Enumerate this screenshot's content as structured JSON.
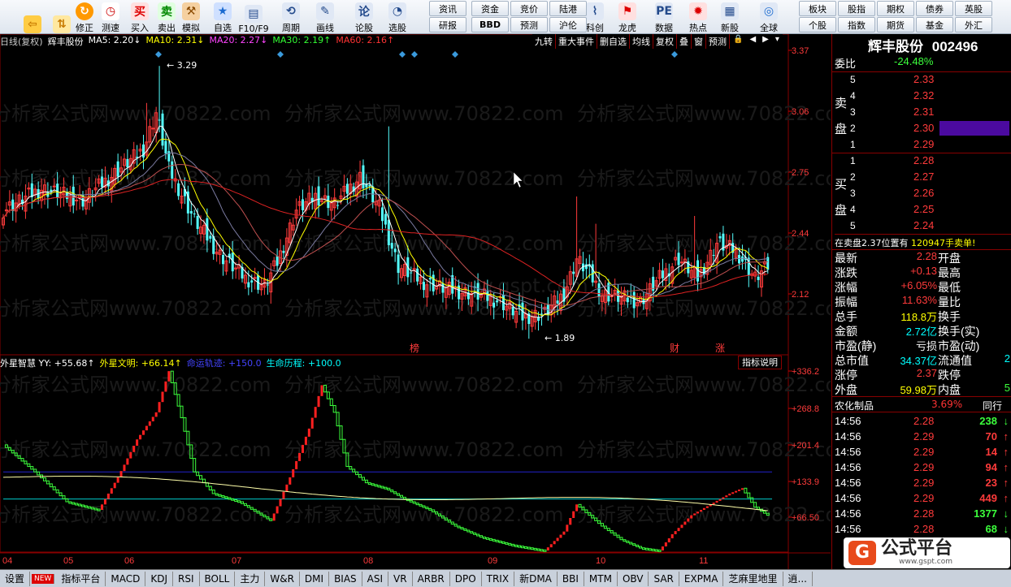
{
  "toolbar": {
    "tall": [
      {
        "label": "",
        "icon": "back-arrow-icon"
      },
      {
        "label": "",
        "icon": "up-down-arrows-icon"
      },
      {
        "label": "修正",
        "icon": "correction-icon"
      },
      {
        "label": "测速",
        "icon": "speed-test-icon"
      },
      {
        "label": "买入",
        "icon": "buy-icon",
        "glyph": "买"
      },
      {
        "label": "卖出",
        "icon": "sell-icon",
        "glyph": "卖"
      },
      {
        "label": "模拟",
        "icon": "simulate-hammer-icon"
      },
      {
        "label": "自选",
        "icon": "favorite-icon"
      },
      {
        "label": "F10/F9",
        "icon": "f10-icon"
      },
      {
        "label": "周期",
        "icon": "period-icon"
      },
      {
        "label": "画线",
        "icon": "draw-line-icon"
      },
      {
        "label": "论股",
        "icon": "forum-icon",
        "glyph": "论"
      },
      {
        "label": "选股",
        "icon": "stock-picker-icon"
      },
      {
        "label": "科创",
        "icon": "tech-board-icon"
      },
      {
        "label": "龙虎",
        "icon": "dragon-tiger-icon"
      },
      {
        "label": "数据",
        "icon": "data-pe-icon",
        "glyph": "PE"
      },
      {
        "label": "热点",
        "icon": "hotspot-icon"
      },
      {
        "label": "新股",
        "icon": "new-stock-icon"
      },
      {
        "label": "全球",
        "icon": "globe-icon"
      }
    ],
    "small_top": [
      "资讯",
      "资金",
      "竞价",
      "陆港"
    ],
    "small_bottom": [
      "研报",
      "BBD",
      "预测",
      "沪伦"
    ],
    "small_right_top": [
      "板块",
      "股指",
      "期权",
      "债券",
      "英股"
    ],
    "small_right_bottom": [
      "个股",
      "指数",
      "期货",
      "基金",
      "外汇"
    ]
  },
  "chart_header": {
    "period": "日线(复权)",
    "stock": "辉丰股份",
    "ma5": "MA5: 2.20↓",
    "ma10": "MA10: 2.31↓",
    "ma20": "MA20: 2.27↓",
    "ma30": "MA30: 2.19↑",
    "ma60": "MA60: 2.16↑"
  },
  "chart_tools": [
    "九转",
    "重大事件",
    "删自选",
    "均线",
    "复权",
    "叠",
    "窗",
    "预测"
  ],
  "indicator_header": {
    "yy": "外星智慧 YY: +55.68↑",
    "wm": "外星文明: +66.14↑",
    "mingyun": "命运轨迹: +150.0",
    "shengming": "生命历程: +100.0",
    "help": "指标说明"
  },
  "price_labels": {
    "high": "3.29",
    "low": "1.89"
  },
  "event_markers": [
    "榜",
    "财",
    "涨"
  ],
  "watermark": "分析家公式网www.70822.com",
  "watermark2": "www.gspt.com",
  "quote": {
    "title": "辉丰股份",
    "code": "002496",
    "weibi_label": "委比",
    "weibi": "-24.48%",
    "sell_label": [
      "卖",
      "盘"
    ],
    "buy_label": [
      "买",
      "盘"
    ],
    "sells": [
      {
        "n": "5",
        "p": "2.33"
      },
      {
        "n": "4",
        "p": "2.32"
      },
      {
        "n": "3",
        "p": "2.31"
      },
      {
        "n": "2",
        "p": "2.30"
      },
      {
        "n": "1",
        "p": "2.29"
      }
    ],
    "buys": [
      {
        "n": "1",
        "p": "2.28"
      },
      {
        "n": "2",
        "p": "2.27"
      },
      {
        "n": "3",
        "p": "2.26"
      },
      {
        "n": "4",
        "p": "2.25"
      },
      {
        "n": "5",
        "p": "2.24"
      }
    ],
    "notice_a": "在卖盘2.37位置有",
    "notice_b": "120947手卖单!",
    "stats": [
      {
        "l": "最新",
        "v": "2.28",
        "r": "开盘",
        "rv": ""
      },
      {
        "l": "涨跌",
        "v": "+0.13",
        "r": "最高",
        "rv": ""
      },
      {
        "l": "涨幅",
        "v": "+6.05%",
        "r": "最低",
        "rv": ""
      },
      {
        "l": "振幅",
        "v": "11.63%",
        "r": "量比",
        "rv": ""
      },
      {
        "l": "总手",
        "v": "118.8万",
        "r": "换手",
        "rv": ""
      },
      {
        "l": "金额",
        "v": "2.72亿",
        "r": "换手(实)",
        "rv": ""
      },
      {
        "l": "市盈(静)",
        "v": "亏损",
        "r": "市盈(动)",
        "rv": ""
      },
      {
        "l": "总市值",
        "v": "34.37亿",
        "r": "流通值",
        "rv": "2"
      },
      {
        "l": "涨停",
        "v": "2.37",
        "r": "跌停",
        "rv": ""
      },
      {
        "l": "外盘",
        "v": "59.98万",
        "r": "内盘",
        "rv": "5"
      }
    ],
    "industry": "农化制品",
    "industry_pct": "3.69%",
    "industry_tail": "同行",
    "ticks": [
      {
        "t": "14:56",
        "p": "2.28",
        "v": "238",
        "d": "down"
      },
      {
        "t": "14:56",
        "p": "2.29",
        "v": "70",
        "d": "up"
      },
      {
        "t": "14:56",
        "p": "2.29",
        "v": "14",
        "d": "up"
      },
      {
        "t": "14:56",
        "p": "2.29",
        "v": "94",
        "d": "up"
      },
      {
        "t": "14:56",
        "p": "2.29",
        "v": "23",
        "d": "up"
      },
      {
        "t": "14:56",
        "p": "2.29",
        "v": "449",
        "d": "up"
      },
      {
        "t": "14:56",
        "p": "2.28",
        "v": "1377",
        "d": "down"
      },
      {
        "t": "14:56",
        "p": "2.28",
        "v": "68",
        "d": "down"
      }
    ],
    "logo": "公式平台",
    "logo_url": "www.gspt.com"
  },
  "bottom_tabs": [
    "设置",
    "NEW",
    "指标平台",
    "MACD",
    "KDJ",
    "RSI",
    "BOLL",
    "主力",
    "W&R",
    "DMI",
    "BIAS",
    "ASI",
    "VR",
    "ARBR",
    "DPO",
    "TRIX",
    "新DMA",
    "BBI",
    "MTM",
    "OBV",
    "SAR",
    "EXPMA",
    "芝麻里地里",
    "逍..."
  ],
  "chart_data": {
    "type": "candlestick",
    "price_axis": [
      "3.37",
      "3.06",
      "2.75",
      "2.44",
      "2.12"
    ],
    "indicator_axis": [
      "+336.2",
      "+268.8",
      "+201.4",
      "+133.9",
      "+66.50"
    ],
    "months": [
      "04",
      "05",
      "06",
      "07",
      "08",
      "09",
      "10",
      "11"
    ],
    "colors": {
      "up": "#ff3b3b",
      "down": "#54ffff",
      "ma5": "#ffffff",
      "ma10": "#ffff00",
      "ma20": "#ff00ff",
      "ma30": "#00ff00",
      "ma60": "#dd2222",
      "red": "#ff2020",
      "green": "#3cff3c"
    }
  }
}
